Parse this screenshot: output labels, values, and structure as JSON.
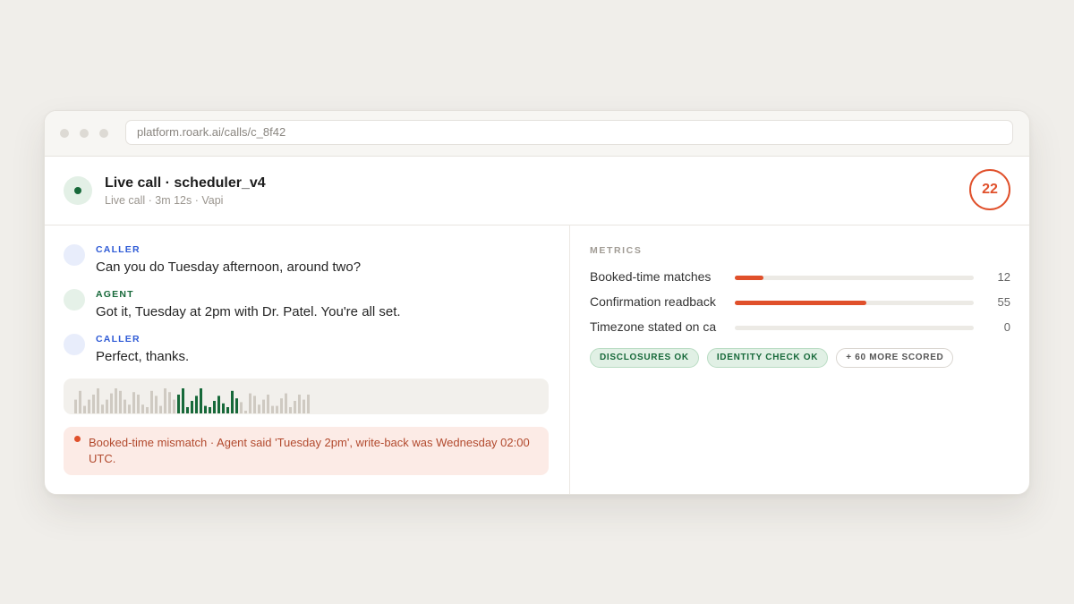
{
  "browser": {
    "url": "platform.roark.ai/calls/c_8f42"
  },
  "call": {
    "title": "Live call · scheduler_v4",
    "subtitle": "Live call · 3m 12s · Vapi",
    "score": "22"
  },
  "transcript": [
    {
      "role": "CALLER",
      "text": "Can you do Tuesday afternoon, around two?"
    },
    {
      "role": "AGENT",
      "text": "Got it, Tuesday at 2pm with Dr. Patel. You're all set."
    },
    {
      "role": "CALLER",
      "text": "Perfect, thanks."
    }
  ],
  "waveform": {
    "colors": {
      "inactive": "#cfcac2",
      "active": "#17693a"
    },
    "active_range": [
      23,
      36
    ],
    "levels": [
      0.55,
      0.9,
      0.3,
      0.55,
      0.75,
      1.0,
      0.35,
      0.55,
      0.8,
      1.0,
      0.9,
      0.55,
      0.35,
      0.85,
      0.75,
      0.35,
      0.25,
      0.9,
      0.7,
      0.3,
      1.0,
      0.85,
      0.55,
      0.75,
      1.0,
      0.25,
      0.5,
      0.7,
      1.0,
      0.3,
      0.25,
      0.5,
      0.7,
      0.4,
      0.25,
      0.9,
      0.6,
      0.45,
      0.1,
      0.8,
      0.7,
      0.35,
      0.55,
      0.75,
      0.3,
      0.3,
      0.6,
      0.8,
      0.25,
      0.5,
      0.75,
      0.55,
      0.75
    ]
  },
  "alert": {
    "color": "#e0502b",
    "text": "Booked-time mismatch · Agent said 'Tuesday 2pm', write-back was Wednesday 02:00 UTC."
  },
  "metrics": {
    "label": "METRICS",
    "accent": "#e0502b",
    "items": [
      {
        "name": "Booked-time matches",
        "value": "12",
        "fraction": 0.12
      },
      {
        "name": "Confirmation readback",
        "value": "55",
        "fraction": 0.55
      },
      {
        "name": "Timezone stated on ca",
        "value": "0",
        "fraction": 0.0
      }
    ],
    "chips": [
      {
        "label": "DISCLOSURES OK",
        "kind": "ok"
      },
      {
        "label": "IDENTITY CHECK OK",
        "kind": "ok"
      },
      {
        "label": "+ 60 MORE SCORED",
        "kind": "more"
      }
    ]
  }
}
